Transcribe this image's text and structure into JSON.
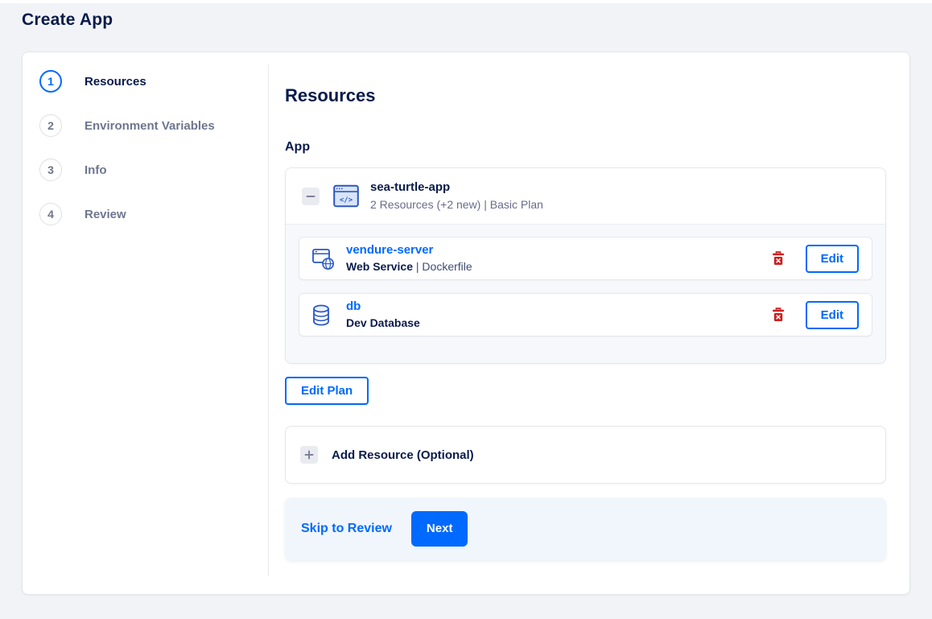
{
  "page": {
    "title": "Create App"
  },
  "stepper": {
    "steps": [
      {
        "number": "1",
        "label": "Resources",
        "active": true
      },
      {
        "number": "2",
        "label": "Environment Variables",
        "active": false
      },
      {
        "number": "3",
        "label": "Info",
        "active": false
      },
      {
        "number": "4",
        "label": "Review",
        "active": false
      }
    ]
  },
  "content": {
    "heading": "Resources",
    "section_label": "App",
    "app": {
      "name": "sea-turtle-app",
      "summary": "2 Resources (+2 new) | Basic Plan",
      "icon": "app-window-code-icon",
      "collapse_icon": "minus-icon"
    },
    "resources": [
      {
        "name": "vendure-server",
        "type": "Web Service",
        "detail": " | Dockerfile",
        "icon": "web-service-globe-icon",
        "delete_icon": "trash-icon",
        "edit_label": "Edit"
      },
      {
        "name": "db",
        "type": "Dev Database",
        "detail": "",
        "icon": "database-icon",
        "delete_icon": "trash-icon",
        "edit_label": "Edit"
      }
    ],
    "edit_plan_label": "Edit Plan",
    "add_resource": {
      "label": "Add Resource (Optional)",
      "icon": "plus-icon"
    },
    "footer": {
      "skip_label": "Skip to Review",
      "next_label": "Next"
    }
  },
  "colors": {
    "accent": "#0069ff",
    "heading": "#081b4b",
    "muted": "#676b89",
    "icon_blue": "#2a56c8",
    "danger": "#cc1f1f",
    "footer_bg": "#f0f6fc",
    "page_bg": "#f1f3f7"
  }
}
